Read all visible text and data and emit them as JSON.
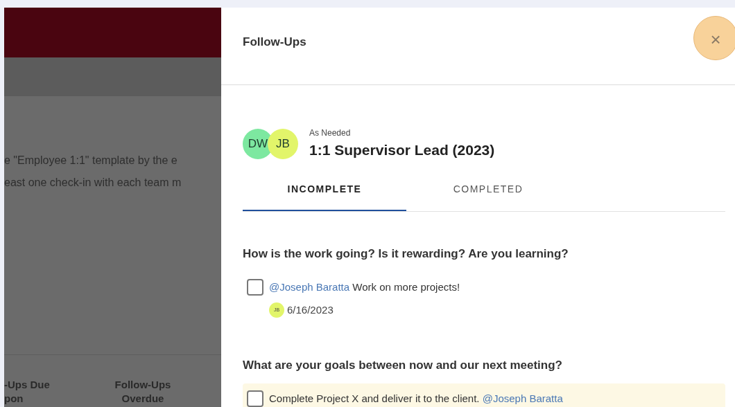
{
  "background": {
    "description_lines": [
      "e \"Employee 1:1\" template by the e",
      "east one check-in with each team m"
    ],
    "stat_labels": [
      {
        "lines": [
          "-Ups Due",
          "pon"
        ]
      },
      {
        "lines": [
          "Follow-Ups",
          "Overdue"
        ]
      }
    ]
  },
  "drawer": {
    "title": "Follow-Ups",
    "close_label": "×",
    "meeting": {
      "participants": [
        {
          "initials": "DW",
          "color": "#7de8a0"
        },
        {
          "initials": "JB",
          "color": "#e2f56a"
        }
      ],
      "frequency": "As Needed",
      "title": "1:1 Supervisor Lead (2023)"
    },
    "tabs": [
      {
        "label": "INCOMPLETE",
        "selected": true
      },
      {
        "label": "COMPLETED",
        "selected": false
      }
    ],
    "sections": [
      {
        "question": "How is the work going? Is it rewarding? Are you learning?",
        "items": [
          {
            "checked": false,
            "highlighted": false,
            "segments": [
              {
                "kind": "mention",
                "text": "@Joseph Baratta"
              },
              {
                "kind": "text",
                "text": " Work on more projects!"
              }
            ],
            "assignee": {
              "initials": "JB",
              "color": "#e2f56a"
            },
            "date": "6/16/2023"
          }
        ]
      },
      {
        "question": "What are your goals between now and our next meeting?",
        "items": [
          {
            "checked": false,
            "highlighted": true,
            "segments": [
              {
                "kind": "text",
                "text": "Complete Project X and deliver it to the client. "
              },
              {
                "kind": "mention",
                "text": "@Joseph Baratta"
              }
            ]
          }
        ]
      }
    ]
  }
}
